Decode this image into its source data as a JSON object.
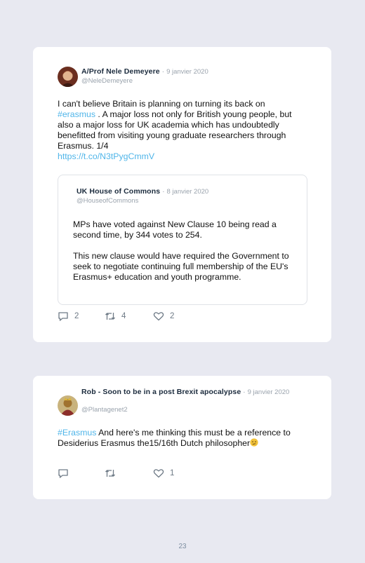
{
  "tweet1": {
    "author": "A/Prof Nele Demeyere",
    "separator": " · ",
    "date": "9 janvier 2020",
    "handle": "@NeleDemeyere",
    "hashtag": "#erasmus",
    "text_before": "I can't believe Britain is planning on turning its back on",
    "text_after": ". A major loss not only for British young people, but also a major loss for UK academia which has undoubtedly benefitted from visiting young graduate researchers through Erasmus. 1/4",
    "link": "https://t.co/N3tPygCmmV",
    "quoted": {
      "author": "UK House of Commons",
      "separator": " · ",
      "date": "8 janvier 2020",
      "handle": "@HouseofCommons",
      "para1": "MPs have voted against New Clause 10 being read a second time, by 344 votes to 254.",
      "para2": "This new clause would have required the Government to seek to negotiate continuing full membership of the EU's Erasmus+ education and youth programme."
    },
    "replies": "2",
    "retweets": "4",
    "likes": "2"
  },
  "tweet2": {
    "author": "Rob - Soon to be in a post Brexit apocalypse",
    "separator": " · ",
    "date": "9 janvier 2020",
    "handle": "@Plantagenet2",
    "hashtag": "#Erasmus",
    "text": " And here's me thinking this must be a reference to Desiderius Erasmus the15/16th Dutch philosopher",
    "emoji_icon": "confused-face-emoji",
    "replies": "",
    "retweets": "",
    "likes": "1"
  },
  "page_number": "23",
  "colors": {
    "link": "#4fb5e9",
    "background": "#e8e9f1",
    "card": "#ffffff"
  }
}
